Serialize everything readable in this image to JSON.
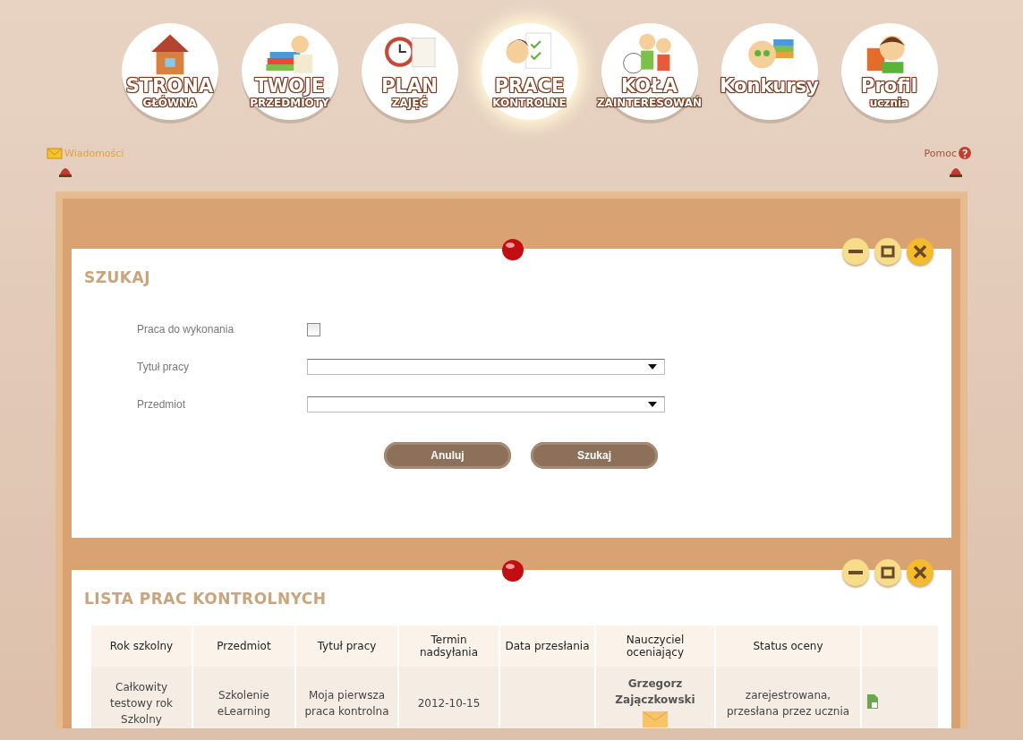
{
  "nav": [
    {
      "lines": [
        "STRONA",
        "GŁÓWNA"
      ],
      "kind": "house",
      "selected": false
    },
    {
      "lines": [
        "TWOJE",
        "PRZEDMIOTY"
      ],
      "kind": "books",
      "selected": false
    },
    {
      "lines": [
        "PLAN",
        "ZAJĘĆ"
      ],
      "kind": "clock",
      "selected": false
    },
    {
      "lines": [
        "PRACE",
        "KONTROLNE"
      ],
      "kind": "papers",
      "selected": true
    },
    {
      "lines": [
        "KOŁA",
        "ZAINTERESOWAŃ"
      ],
      "kind": "ball",
      "selected": false
    },
    {
      "lines": [
        "Konkursy"
      ],
      "kind": "stack",
      "selected": false
    },
    {
      "lines": [
        "Profil",
        "ucznia"
      ],
      "kind": "person",
      "selected": false
    }
  ],
  "top_links": {
    "messages": "Wiadomości",
    "help": "Pomoc"
  },
  "search_panel": {
    "title": "SZUKAJ",
    "fields": [
      {
        "label": "Praca do wykonania",
        "kind": "checkbox",
        "checked": false
      },
      {
        "label": "Tytuł pracy",
        "kind": "select"
      },
      {
        "label": "Przedmiot",
        "kind": "select"
      }
    ],
    "buttons": [
      "Anuluj",
      "Szukaj"
    ]
  },
  "list_panel": {
    "title": "LISTA PRAC KONTROLNYCH",
    "table": {
      "columns": [
        "Rok szkolny",
        "Przedmiot",
        "Tytuł pracy",
        "Termin nadsyłania",
        "Data przesłania",
        "Nauczyciel oceniający",
        "Status oceny",
        ""
      ],
      "rows": [
        {
          "year": "Całkowity testowy rok Szkolny",
          "subject": "Szkolenie eLearning",
          "title": "Moja pierwsza praca kontrolna",
          "deadline": "2012-10-15",
          "sent": "",
          "teacher": "Grzegorz Zajączkowski",
          "status": "zarejestrowana, przesłana przez ucznia"
        }
      ]
    }
  }
}
